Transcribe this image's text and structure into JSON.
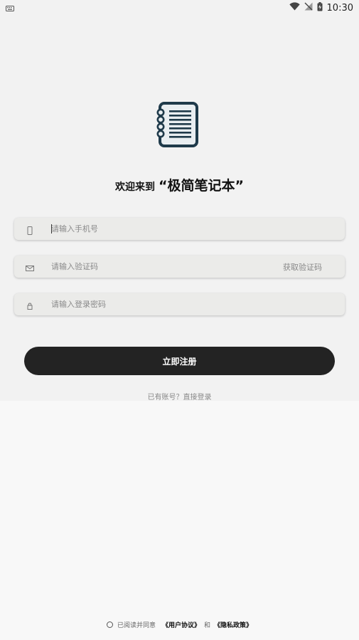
{
  "status_bar": {
    "time": "10:30",
    "icons": [
      "keyboard-icon",
      "wifi-icon",
      "no-signal-icon",
      "battery-charging-icon"
    ]
  },
  "logo": {
    "icon": "notebook-icon",
    "colors": {
      "stroke": "#1f3a4a",
      "fill": "#e9eef1"
    }
  },
  "welcome": {
    "prefix": "欢迎来到",
    "app_name": "“极简笔记本”"
  },
  "form": {
    "phone": {
      "icon": "phone-icon",
      "placeholder": "请输入手机号",
      "value": ""
    },
    "code": {
      "icon": "mail-icon",
      "placeholder": "请输入验证码",
      "value": "",
      "get_code_label": "获取验证码"
    },
    "password": {
      "icon": "lock-icon",
      "placeholder": "请输入登录密码",
      "value": ""
    }
  },
  "register_button": {
    "label": "立即注册",
    "color": "#232323"
  },
  "login_link": {
    "text": "已有账号？直接登录"
  },
  "agreement": {
    "prefix": "已阅读并同意",
    "user_agreement": "《用户协议》",
    "and": "和",
    "privacy_policy": "《隐私政策》"
  }
}
